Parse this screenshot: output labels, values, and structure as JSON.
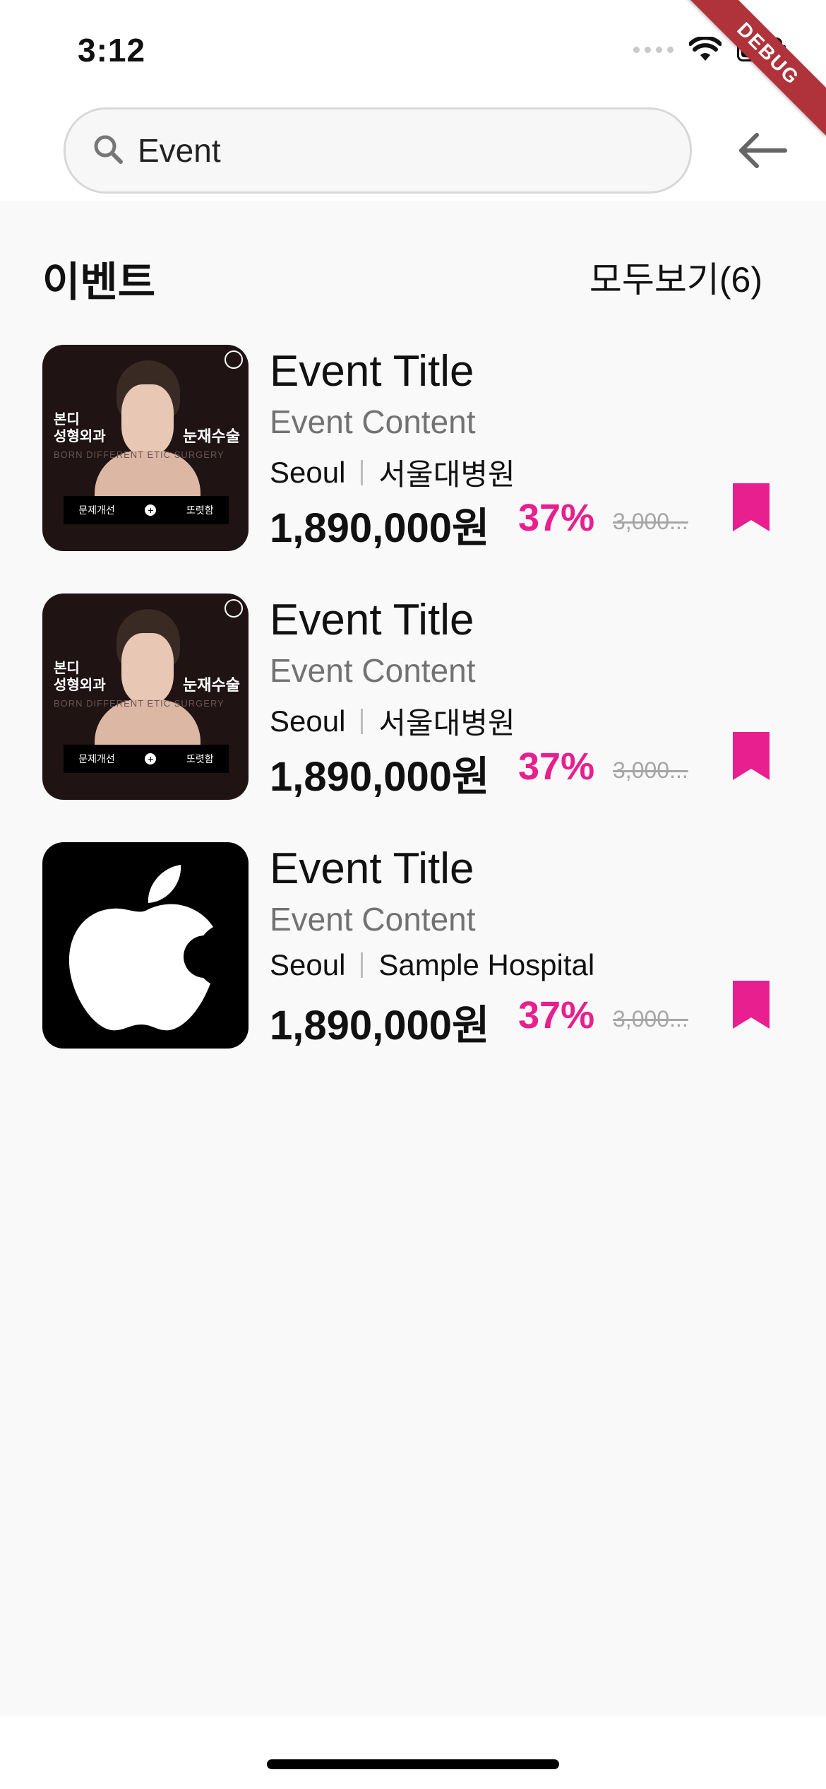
{
  "status_bar": {
    "time": "3:12"
  },
  "debug_banner": "DEBUG",
  "search": {
    "value": "Event"
  },
  "section": {
    "title": "이벤트",
    "see_all": "모두보기(6)"
  },
  "events": [
    {
      "thumb": "ad",
      "ad": {
        "clinic": "본디\n성형외과",
        "procedure": "눈재수술",
        "sub": "BORN DIFFERENT  ETIC SURGERY",
        "left": "문제개선",
        "right": "또렷함"
      },
      "title": "Event Title",
      "content": "Event Content",
      "city": "Seoul",
      "hospital": "서울대병원",
      "price": "1,890,000원",
      "discount": "37%",
      "original": "3,000..."
    },
    {
      "thumb": "ad",
      "ad": {
        "clinic": "본디\n성형외과",
        "procedure": "눈재수술",
        "sub": "BORN DIFFERENT  ETIC SURGERY",
        "left": "문제개선",
        "right": "또렷함"
      },
      "title": "Event Title",
      "content": "Event Content",
      "city": "Seoul",
      "hospital": "서울대병원",
      "price": "1,890,000원",
      "discount": "37%",
      "original": "3,000..."
    },
    {
      "thumb": "apple",
      "title": "Event Title",
      "content": "Event Content",
      "city": "Seoul",
      "hospital": "Sample Hospital",
      "price": "1,890,000원",
      "discount": "37%",
      "original": "3,000..."
    }
  ],
  "colors": {
    "accent": "#e81f8e",
    "background": "#f9f9f9",
    "muted": "#727272"
  }
}
